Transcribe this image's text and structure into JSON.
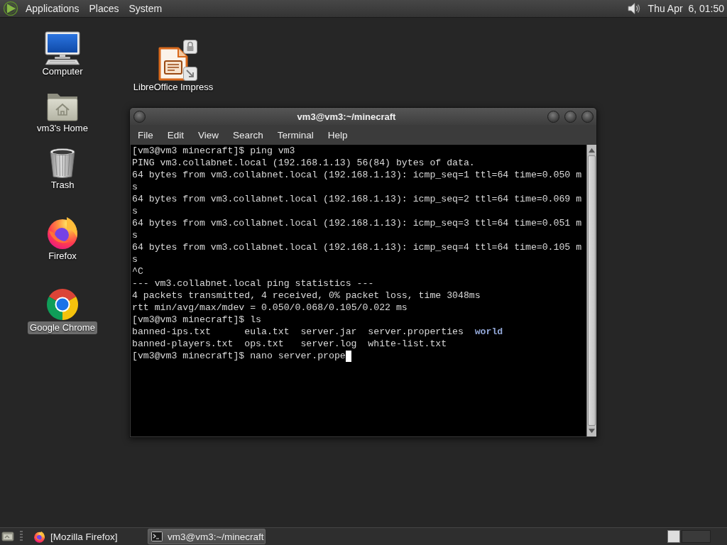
{
  "top_panel": {
    "menus": [
      "Applications",
      "Places",
      "System"
    ],
    "clock": "Thu Apr  6, 01:50"
  },
  "desktop_icons": [
    {
      "label": "Computer",
      "kind": "computer",
      "selected": false
    },
    {
      "label": "vm3's Home",
      "kind": "home",
      "selected": false
    },
    {
      "label": "Trash",
      "kind": "trash",
      "selected": false
    },
    {
      "label": "Firefox",
      "kind": "firefox",
      "selected": false
    },
    {
      "label": "Google Chrome",
      "kind": "chrome",
      "selected": true
    },
    {
      "label": "LibreOffice Impress",
      "kind": "impress",
      "selected": false
    }
  ],
  "terminal_window": {
    "title": "vm3@vm3:~/minecraft",
    "menu": [
      "File",
      "Edit",
      "View",
      "Search",
      "Terminal",
      "Help"
    ],
    "cursor": true,
    "lines": [
      {
        "kind": "text",
        "text": "[vm3@vm3 minecraft]$ ping vm3"
      },
      {
        "kind": "text",
        "text": "PING vm3.collabnet.local (192.168.1.13) 56(84) bytes of data."
      },
      {
        "kind": "text",
        "text": "64 bytes from vm3.collabnet.local (192.168.1.13): icmp_seq=1 ttl=64 time=0.050 m"
      },
      {
        "kind": "text",
        "text": "s"
      },
      {
        "kind": "text",
        "text": "64 bytes from vm3.collabnet.local (192.168.1.13): icmp_seq=2 ttl=64 time=0.069 m"
      },
      {
        "kind": "text",
        "text": "s"
      },
      {
        "kind": "text",
        "text": "64 bytes from vm3.collabnet.local (192.168.1.13): icmp_seq=3 ttl=64 time=0.051 m"
      },
      {
        "kind": "text",
        "text": "s"
      },
      {
        "kind": "text",
        "text": "64 bytes from vm3.collabnet.local (192.168.1.13): icmp_seq=4 ttl=64 time=0.105 m"
      },
      {
        "kind": "text",
        "text": "s"
      },
      {
        "kind": "text",
        "text": "^C"
      },
      {
        "kind": "text",
        "text": "--- vm3.collabnet.local ping statistics ---"
      },
      {
        "kind": "text",
        "text": "4 packets transmitted, 4 received, 0% packet loss, time 3048ms"
      },
      {
        "kind": "text",
        "text": "rtt min/avg/max/mdev = 0.050/0.068/0.105/0.022 ms"
      },
      {
        "kind": "text",
        "text": "[vm3@vm3 minecraft]$ ls"
      },
      {
        "kind": "listing",
        "rows": [
          [
            {
              "name": "banned-ips.txt",
              "kind": "file"
            },
            {
              "name": "eula.txt",
              "kind": "file"
            },
            {
              "name": "server.jar",
              "kind": "file"
            },
            {
              "name": "server.properties",
              "kind": "file"
            },
            {
              "name": "world",
              "kind": "directory"
            }
          ],
          [
            {
              "name": "banned-players.txt",
              "kind": "file"
            },
            {
              "name": "ops.txt",
              "kind": "file"
            },
            {
              "name": "server.log",
              "kind": "file"
            },
            {
              "name": "white-list.txt",
              "kind": "file"
            }
          ]
        ]
      },
      {
        "kind": "text",
        "text": "[vm3@vm3 minecraft]$ nano server.prope"
      }
    ]
  },
  "taskbar": {
    "buttons": [
      {
        "label": "[Mozilla Firefox]",
        "kind": "firefox",
        "selected": false
      },
      {
        "label": "vm3@vm3:~/minecraft",
        "kind": "terminal",
        "selected": true
      }
    ]
  }
}
